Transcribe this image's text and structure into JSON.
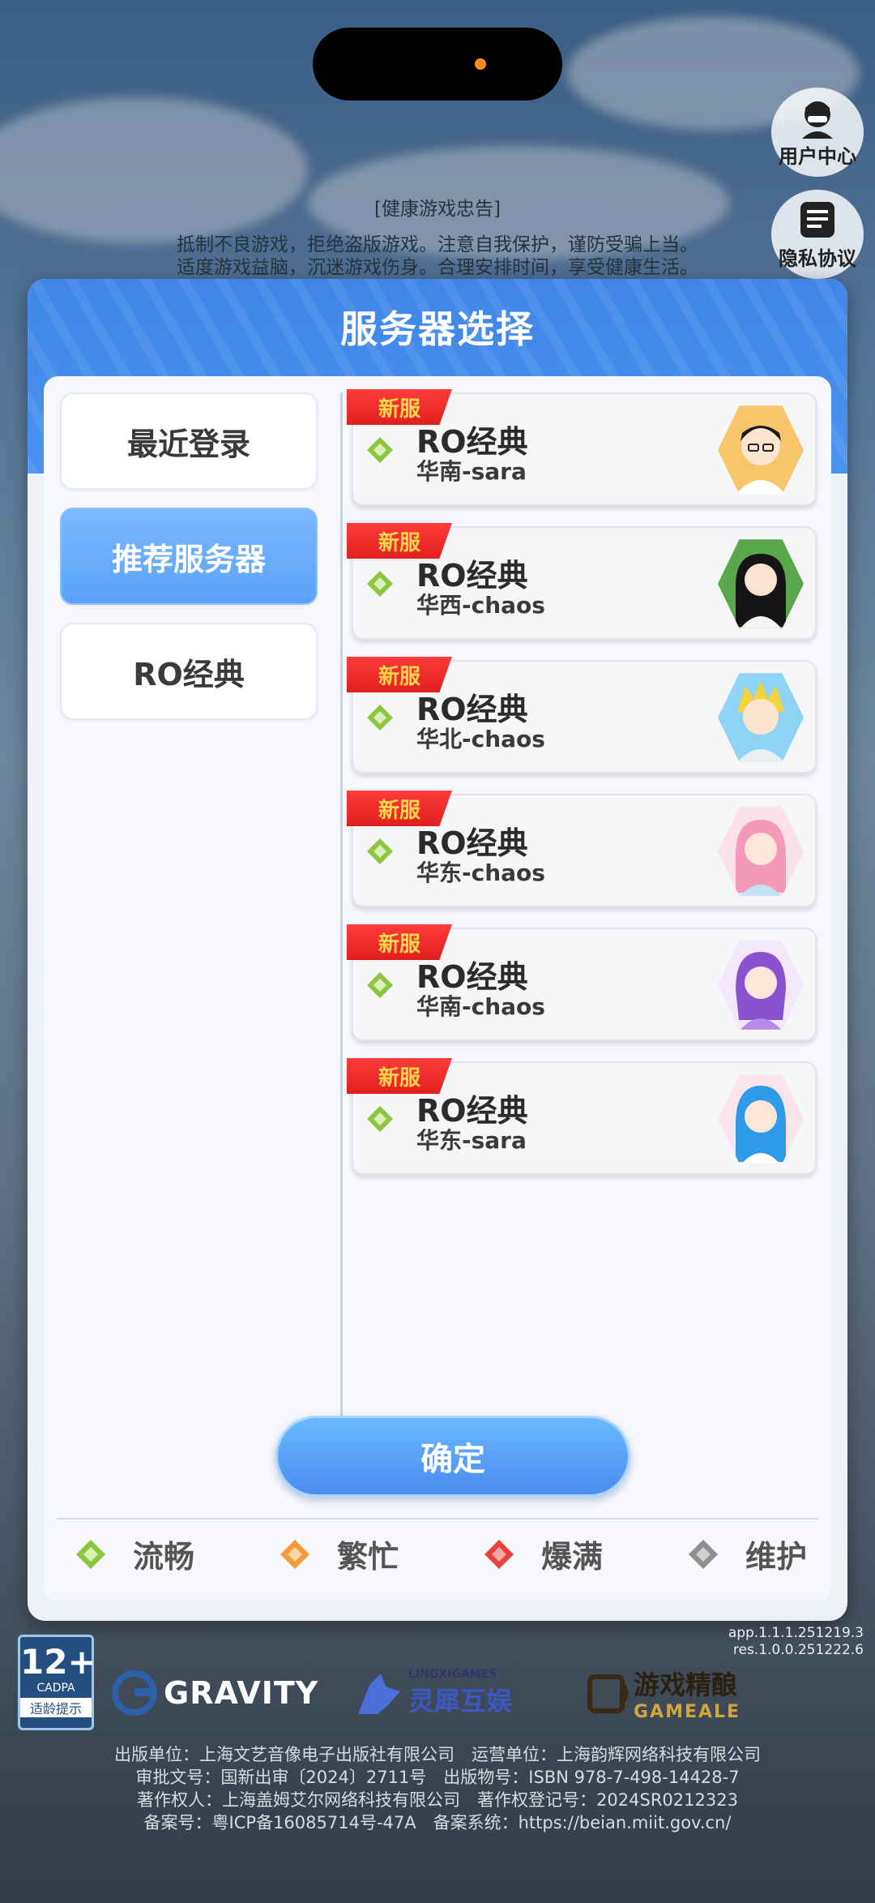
{
  "top": {
    "user_center": "用户中心",
    "privacy": "隐私协议",
    "notice_title": "[健康游戏忠告]",
    "notice_line1": "抵制不良游戏，拒绝盗版游戏。注意自我保护，谨防受骗上当。",
    "notice_line2": "适度游戏益脑，沉迷游戏伤身。合理安排时间，享受健康生活。"
  },
  "modal": {
    "title": "服务器选择",
    "categories": [
      {
        "label": "最近登录",
        "active": false
      },
      {
        "label": "推荐服务器",
        "active": true
      },
      {
        "label": "RO经典",
        "active": false
      }
    ],
    "servers": [
      {
        "tag": "新服",
        "name": "RO经典",
        "sub": "华南-sara",
        "status": "流畅"
      },
      {
        "tag": "新服",
        "name": "RO经典",
        "sub": "华西-chaos",
        "status": "流畅"
      },
      {
        "tag": "新服",
        "name": "RO经典",
        "sub": "华北-chaos",
        "status": "流畅"
      },
      {
        "tag": "新服",
        "name": "RO经典",
        "sub": "华东-chaos",
        "status": "流畅"
      },
      {
        "tag": "新服",
        "name": "RO经典",
        "sub": "华南-chaos",
        "status": "流畅"
      },
      {
        "tag": "新服",
        "name": "RO经典",
        "sub": "华东-sara",
        "status": "流畅"
      }
    ],
    "confirm": "确定",
    "legend": [
      {
        "label": "流畅",
        "color": "#8cc63f"
      },
      {
        "label": "繁忙",
        "color": "#f39a3b"
      },
      {
        "label": "爆满",
        "color": "#e8413e"
      },
      {
        "label": "维护",
        "color": "#8e8e8e"
      }
    ]
  },
  "footer": {
    "version_app": "app.1.1.1.251219.3",
    "version_res": "res.1.0.0.251222.6",
    "age_rating": "12+",
    "age_org": "CADPA",
    "age_tip": "适龄提示",
    "logo_gravity": "GRAVITY",
    "logo_lingxi_en": "LINGXIGAMES",
    "logo_lingxi_cn": "灵犀互娱",
    "logo_gameale_cn": "游戏精酿",
    "logo_gameale_en": "GAMEALE",
    "line1": "出版单位：上海文艺音像电子出版社有限公司　运营单位：上海韵辉网络科技有限公司",
    "line2": "审批文号：国新出审〔2024〕2711号　出版物号：ISBN 978-7-498-14428-7",
    "line3": "著作权人：上海盖姆艾尔网络科技有限公司　著作权登记号：2024SR0212323",
    "line4": "备案号：粤ICP备16085714号-47A　备案系统：https://beian.miit.gov.cn/"
  },
  "colors": {
    "accent": "#4a92ee",
    "tag_red": "#e0201e",
    "tag_text": "#ffd84a"
  },
  "icons": [
    "user-center-icon",
    "privacy-icon",
    "status-diamond-icon"
  ]
}
